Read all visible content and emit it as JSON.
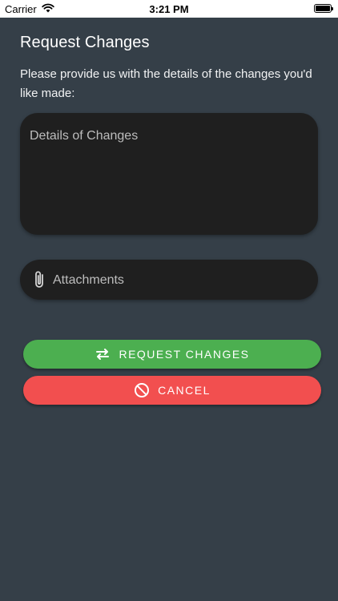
{
  "status": {
    "carrier": "Carrier",
    "time": "3:21 PM"
  },
  "page": {
    "title": "Request Changes",
    "description": "Please provide us with the details of the changes you'd like made:"
  },
  "details_input": {
    "placeholder": "Details of Changes",
    "value": ""
  },
  "attachments": {
    "label": "Attachments"
  },
  "buttons": {
    "request_label": "REQUEST CHANGES",
    "cancel_label": "CANCEL"
  },
  "colors": {
    "background": "#353f48",
    "field": "#1f1f1f",
    "request": "#4caf50",
    "cancel": "#f24f4f"
  },
  "icons": {
    "status": [
      "wifi-icon",
      "battery-icon"
    ],
    "attachments": "paperclip-icon",
    "request": "swap-arrows-icon",
    "cancel": "block-icon"
  }
}
